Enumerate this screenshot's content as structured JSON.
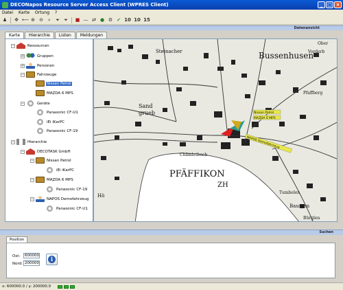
{
  "window": {
    "title": "DECONapos Resource Server Access Client (WPRES Client)"
  },
  "menu": [
    "Datei",
    "Karte",
    "Ortung",
    "?"
  ],
  "toolbar": {
    "numbers": [
      "10",
      "10",
      "15"
    ]
  },
  "header_right": "Datenansicht",
  "tabs": [
    "Karte",
    "Hierarchie",
    "Listen",
    "Meldungen"
  ],
  "tree": [
    {
      "label": "Ressourcen",
      "icon": "ressource-icon",
      "expander": "−"
    },
    {
      "label": "Gruppen",
      "icon": "group-icon",
      "expander": "+"
    },
    {
      "label": "Personen",
      "icon": "person-icon",
      "expander": "+"
    },
    {
      "label": "Fahrzeuge",
      "icon": "vehicle-icon",
      "expander": "−"
    },
    {
      "label": "Nissan Patrol",
      "icon": "vehicle-icon",
      "selected": true
    },
    {
      "label": "MAZDA 6 MPS",
      "icon": "vehicle-icon"
    },
    {
      "label": "Geräte",
      "icon": "device-icon",
      "expander": "−"
    },
    {
      "label": "Panasonic CF-U1",
      "icon": "device-icon"
    },
    {
      "label": "iEi iKarPC",
      "icon": "device-icon"
    },
    {
      "label": "Panasonic CF-19",
      "icon": "device-icon"
    },
    {
      "label": "Hierarchie",
      "icon": "hierarchy-icon",
      "expander": "−"
    },
    {
      "label": "DECOTASK GmbH",
      "icon": "ressource-icon",
      "expander": "−"
    },
    {
      "label": "Nissan Patrol",
      "icon": "vehicle-icon",
      "expander": "−"
    },
    {
      "label": "iEi iKarPC",
      "icon": "device-icon"
    },
    {
      "label": "MAZDA 6 MPS",
      "icon": "vehicle-icon",
      "expander": "−"
    },
    {
      "label": "Panasonic CF-19",
      "icon": "device-icon"
    },
    {
      "label": "NAPOS Demofahrzeug",
      "icon": "person-icon",
      "expander": "−"
    },
    {
      "label": "Panasonic CF-U1",
      "icon": "device-icon"
    }
  ],
  "map": {
    "labels": [
      "Steinacher",
      "Bussenhusen",
      "Sand",
      "grueb",
      "PFÄFFIKON",
      "ZH",
      "Hö",
      "Baumen",
      "Tumbelen",
      "Bürglen",
      "Ober",
      "Vorderb",
      "Pfaffberg",
      "Chämletbach"
    ],
    "marker_labels": [
      "Nissan Patrol",
      "MAZDA 6 MPS",
      "NAPOS Demofahrzeug"
    ]
  },
  "search": {
    "header": "Suchen",
    "tab": "Position"
  },
  "position": {
    "ost_label": "Ost:",
    "ost_value": "600000",
    "nord_label": "Nord:",
    "nord_value": "200000"
  },
  "status": {
    "coords": "x: 600000.0 / y: 200000.0"
  },
  "colors": {
    "title_blue": "#0a5bd4",
    "header_blue": "#b8cbe8",
    "select_blue": "#316ac5",
    "lake": "#ffffff"
  }
}
